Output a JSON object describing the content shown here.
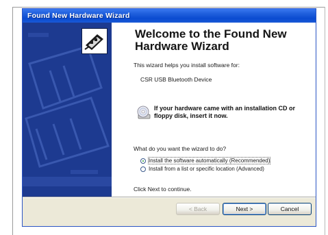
{
  "window": {
    "title": "Found New Hardware Wizard"
  },
  "content": {
    "heading": "Welcome to the Found New Hardware Wizard",
    "intro": "This wizard helps you install software for:",
    "device_name": "CSR USB Bluetooth Device",
    "cd_prompt": "If your hardware came with an installation CD or floppy disk, insert it now.",
    "question": "What do you want the wizard to do?",
    "options": [
      {
        "label": "Install the software automatically (Recommended)",
        "selected": true
      },
      {
        "label": "Install from a list or specific location (Advanced)",
        "selected": false
      }
    ],
    "footer": "Click Next to continue."
  },
  "buttons": {
    "back": "< Back",
    "next": "Next >",
    "cancel": "Cancel"
  },
  "colors": {
    "titlebar": "#0a4bd0",
    "sidepanel": "#1d3a90",
    "dialog_bg": "#ece9d8"
  },
  "icons": {
    "wizard": "hardware-card-icon",
    "cd": "cd-disk-icon"
  }
}
